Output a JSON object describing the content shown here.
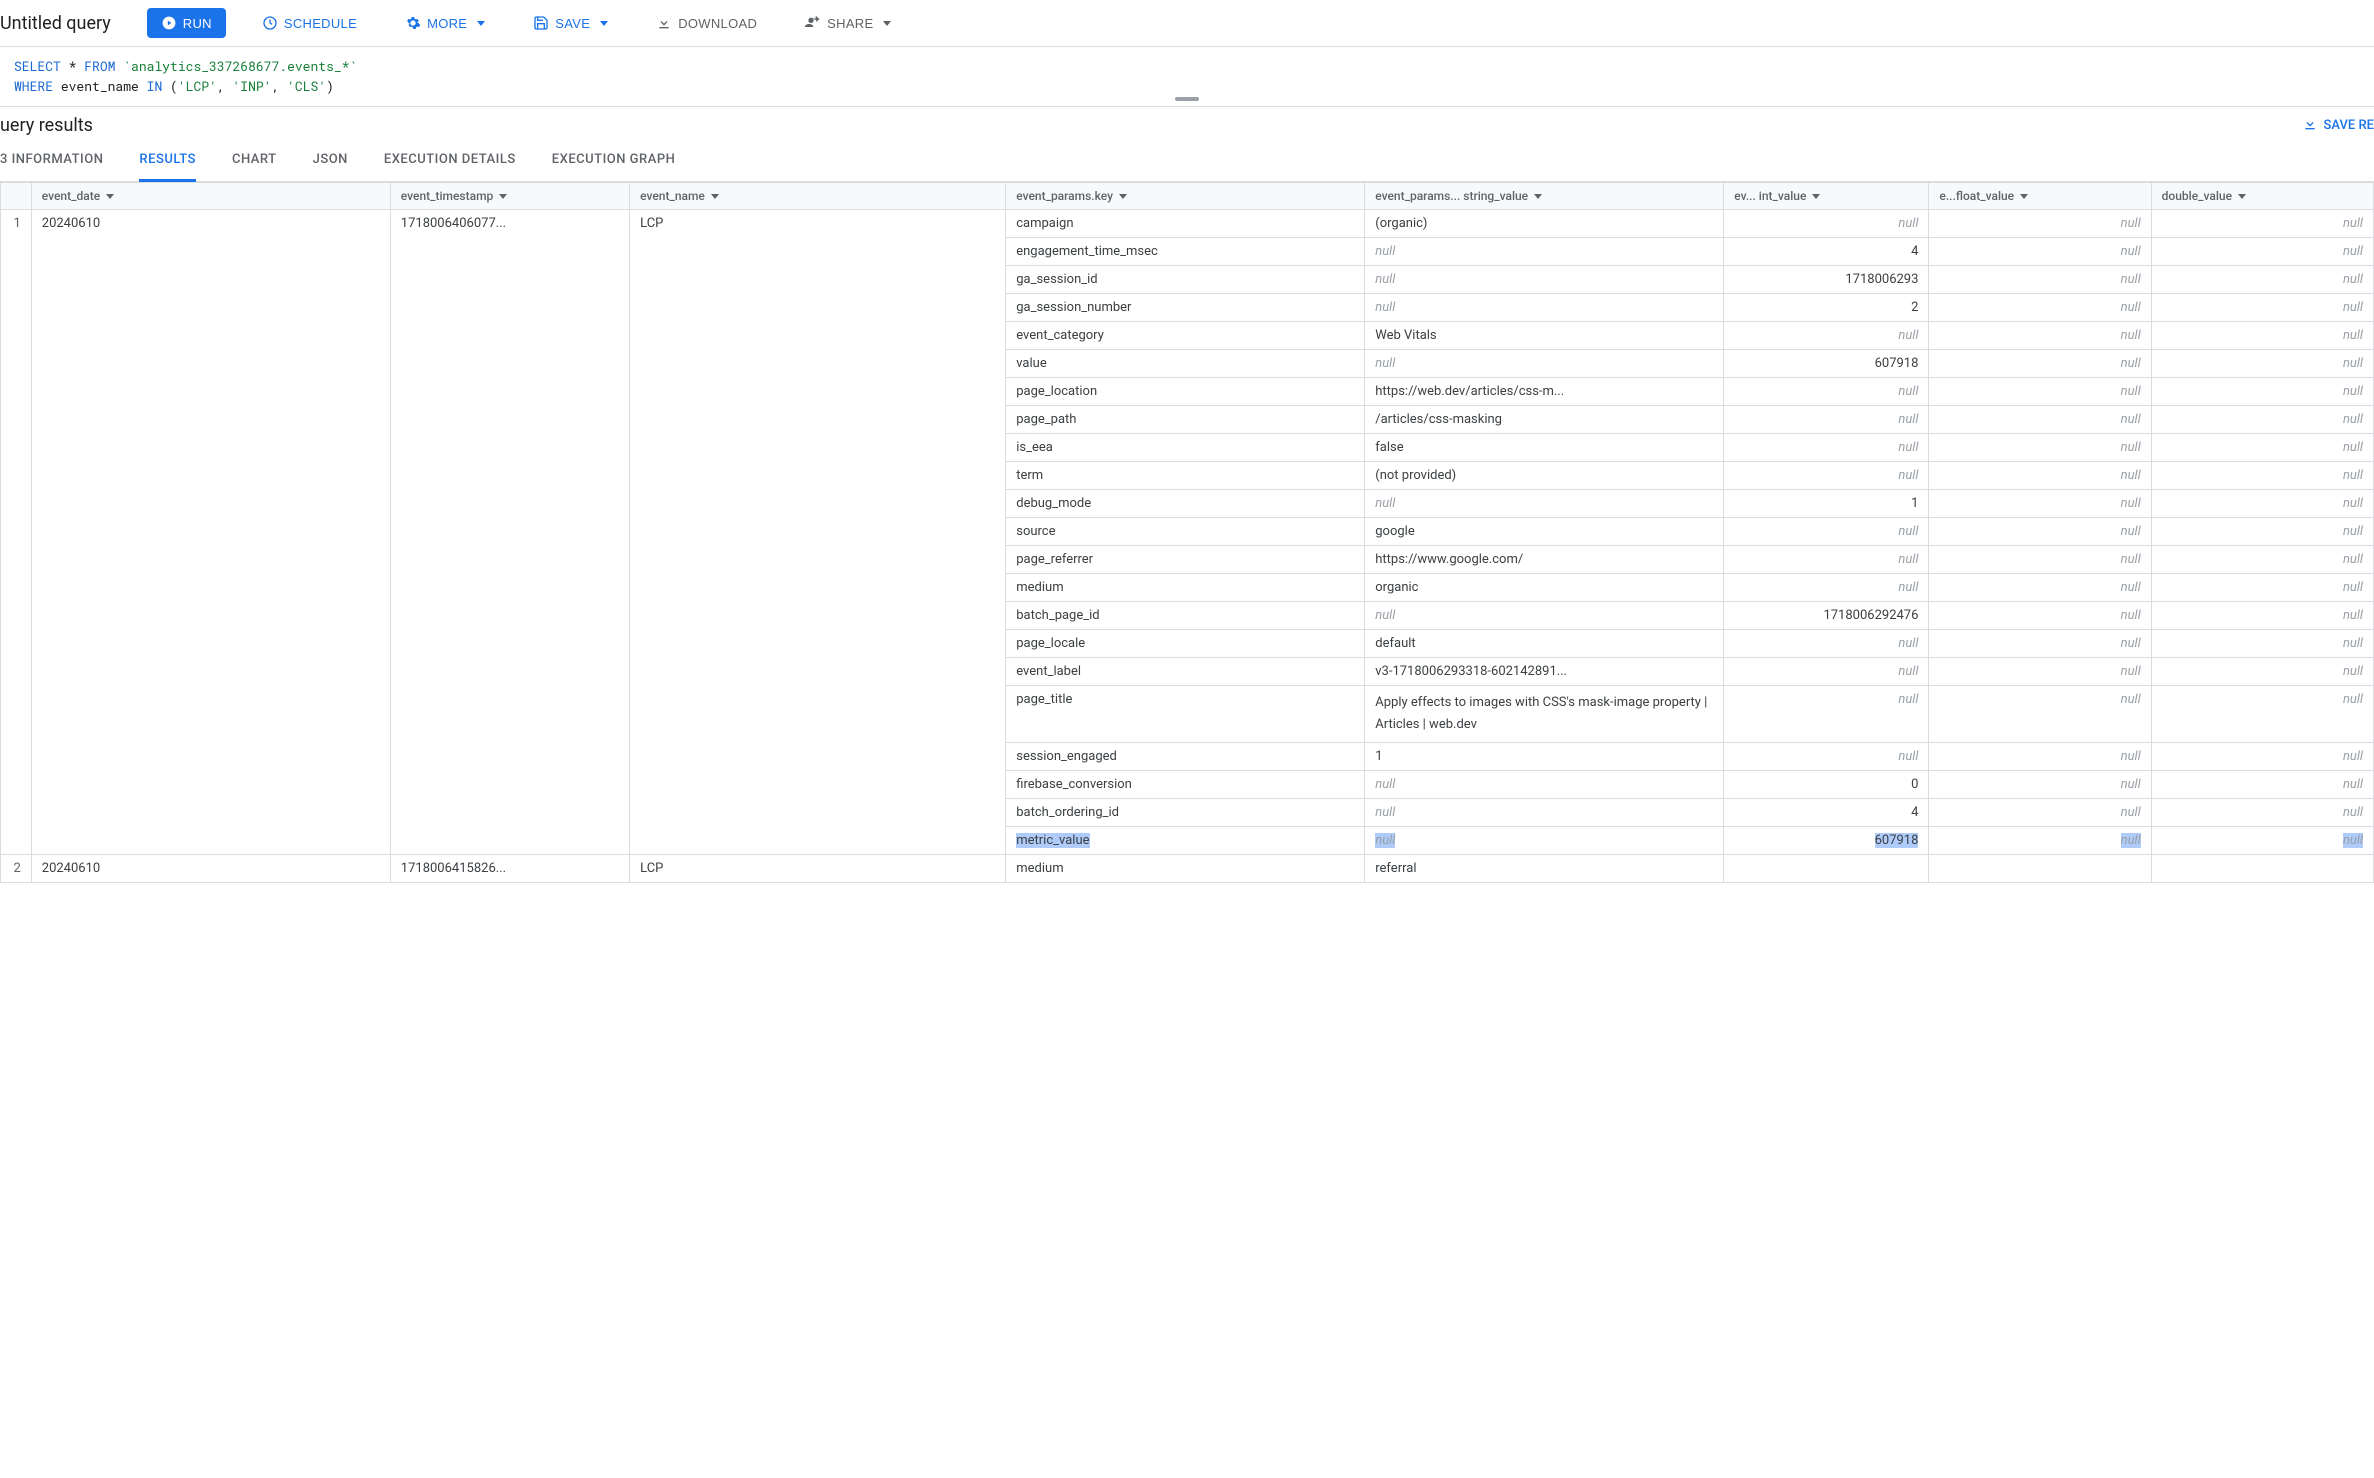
{
  "toolbar": {
    "title": "Untitled query",
    "run": "RUN",
    "schedule": "SCHEDULE",
    "more": "MORE",
    "save": "SAVE",
    "download": "DOWNLOAD",
    "share": "SHARE"
  },
  "sql": {
    "line1_kw1": "SELECT",
    "line1_star": " * ",
    "line1_kw2": "FROM",
    "line1_tbl": " `analytics_337268677.events_*`",
    "line2_kw1": "WHERE",
    "line2_txt1": " event_name ",
    "line2_kw2": "IN",
    "line2_paren1": " (",
    "line2_s1": "'LCP'",
    "line2_c1": ", ",
    "line2_s2": "'INP'",
    "line2_c2": ", ",
    "line2_s3": "'CLS'",
    "line2_paren2": ")"
  },
  "results": {
    "title": "uery results",
    "save_results": "SAVE RE"
  },
  "tabs": {
    "info": "3 INFORMATION",
    "results": "RESULTS",
    "chart": "CHART",
    "json": "JSON",
    "exec_details": "EXECUTION DETAILS",
    "exec_graph": "EXECUTION GRAPH"
  },
  "headers": {
    "event_date": "event_date",
    "event_timestamp": "event_timestamp",
    "event_name": "event_name",
    "key": "event_params.key",
    "string_value": "event_params... string_value",
    "int_value": "ev... int_value",
    "float_value": "e...float_value",
    "double_value": "double_value"
  },
  "row1": {
    "num": "1",
    "date": "20240610",
    "ts": "1718006406077...",
    "name": "LCP"
  },
  "row2": {
    "num": "2",
    "date": "20240610",
    "ts": "1718006415826...",
    "name": "LCP",
    "key": "medium",
    "str": "referral"
  },
  "params": [
    {
      "key": "campaign",
      "str": "(organic)",
      "int": null,
      "float": null,
      "double": null
    },
    {
      "key": "engagement_time_msec",
      "str": null,
      "int": "4",
      "float": null,
      "double": null
    },
    {
      "key": "ga_session_id",
      "str": null,
      "int": "1718006293",
      "float": null,
      "double": null
    },
    {
      "key": "ga_session_number",
      "str": null,
      "int": "2",
      "float": null,
      "double": null
    },
    {
      "key": "event_category",
      "str": "Web Vitals",
      "int": null,
      "float": null,
      "double": null
    },
    {
      "key": "value",
      "str": null,
      "int": "607918",
      "float": null,
      "double": null
    },
    {
      "key": "page_location",
      "str": "https://web.dev/articles/css-m...",
      "int": null,
      "float": null,
      "double": null
    },
    {
      "key": "page_path",
      "str": "/articles/css-masking",
      "int": null,
      "float": null,
      "double": null
    },
    {
      "key": "is_eea",
      "str": "false",
      "int": null,
      "float": null,
      "double": null
    },
    {
      "key": "term",
      "str": "(not provided)",
      "int": null,
      "float": null,
      "double": null
    },
    {
      "key": "debug_mode",
      "str": null,
      "int": "1",
      "float": null,
      "double": null
    },
    {
      "key": "source",
      "str": "google",
      "int": null,
      "float": null,
      "double": null
    },
    {
      "key": "page_referrer",
      "str": "https://www.google.com/",
      "int": null,
      "float": null,
      "double": null
    },
    {
      "key": "medium",
      "str": "organic",
      "int": null,
      "float": null,
      "double": null
    },
    {
      "key": "batch_page_id",
      "str": null,
      "int": "1718006292476",
      "float": null,
      "double": null
    },
    {
      "key": "page_locale",
      "str": "default",
      "int": null,
      "float": null,
      "double": null
    },
    {
      "key": "event_label",
      "str": "v3-1718006293318-602142891...",
      "int": null,
      "float": null,
      "double": null
    },
    {
      "key": "page_title",
      "str": "Apply effects to images with CSS's mask-image property  |  Articles  |  web.dev",
      "int": null,
      "float": null,
      "double": null,
      "tall": true
    },
    {
      "key": "session_engaged",
      "str": "1",
      "int": null,
      "float": null,
      "double": null
    },
    {
      "key": "firebase_conversion",
      "str": null,
      "int": "0",
      "float": null,
      "double": null
    },
    {
      "key": "batch_ordering_id",
      "str": null,
      "int": "4",
      "float": null,
      "double": null
    },
    {
      "key": "metric_value",
      "str": null,
      "int": "607918",
      "float": null,
      "double": null,
      "hl": true
    }
  ],
  "null_text": "null"
}
